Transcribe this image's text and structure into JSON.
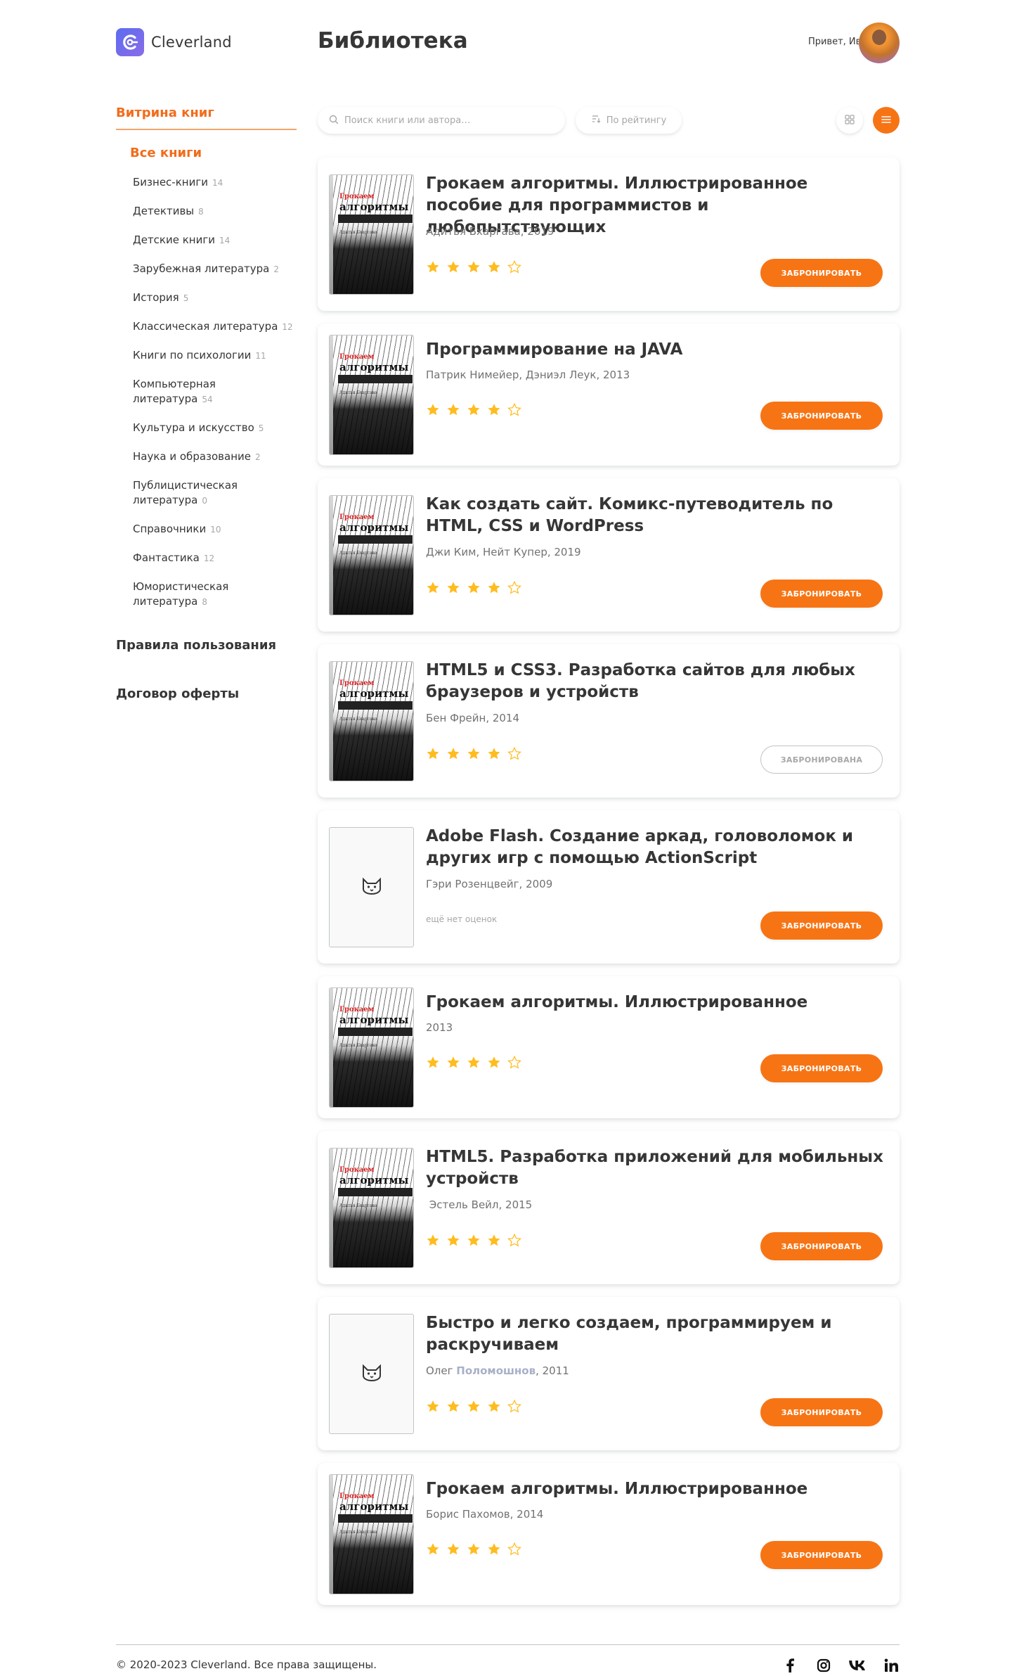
{
  "header": {
    "logo_text": "Cleverland",
    "page_title": "Библиотека",
    "greeting": "Привет, Иван!"
  },
  "sidebar": {
    "showcase_label": "Витрина книг",
    "all_books_label": "Все книги",
    "categories": [
      {
        "label": "Бизнес-книги",
        "count": "14"
      },
      {
        "label": "Детективы",
        "count": "8"
      },
      {
        "label": "Детские книги",
        "count": "14"
      },
      {
        "label": "Зарубежная литература",
        "count": "2"
      },
      {
        "label": "История",
        "count": "5"
      },
      {
        "label": "Классическая литература",
        "count": "12"
      },
      {
        "label": "Книги по психологии",
        "count": "11"
      },
      {
        "label": "Компьютерная литература",
        "count": "54"
      },
      {
        "label": "Культура и искусство",
        "count": "5"
      },
      {
        "label": "Наука и образование",
        "count": "2"
      },
      {
        "label": "Публицистическая литература",
        "count": "0"
      },
      {
        "label": "Справочники",
        "count": "10"
      },
      {
        "label": "Фантастика",
        "count": "12"
      },
      {
        "label": "Юмористическая литература",
        "count": "8"
      }
    ],
    "rules_label": "Правила пользования",
    "offer_label": "Договор оферты"
  },
  "toolbar": {
    "search_placeholder": "Поиск книги или автора…",
    "sort_label": "По рейтингу",
    "view_tile_icon": "grid-icon",
    "view_list_icon": "list-icon"
  },
  "colors": {
    "accent": "#f77414",
    "star": "#ffbc1f",
    "text": "#363636"
  },
  "books": [
    {
      "title": "Грокаем алгоритмы. Иллюстрированное пособие для программистов и любопытствующих",
      "author": "Адитья Бхаргава, 2019",
      "rating": 4,
      "has_cover": true,
      "button": "Забронировать",
      "booked": false
    },
    {
      "title": "Программирование на JAVA",
      "author": "Патрик Нимейер, Дэниэл Леук, 2013",
      "rating": 4,
      "has_cover": true,
      "button": "Забронировать",
      "booked": false
    },
    {
      "title": "Как создать сайт. Комикс-путеводитель по HTML, CSS и WordPress",
      "author": "Джи Ким, Нейт Купер, 2019",
      "rating": 4,
      "has_cover": true,
      "button": "Забронировать",
      "booked": false
    },
    {
      "title": "HTML5 и CSS3. Разработка сайтов для любых браузеров и устройств",
      "author": "Бен Фрейн, 2014",
      "rating": 4,
      "has_cover": true,
      "button": "Забронирована",
      "booked": true
    },
    {
      "title": "Adobe Flash. Создание аркад, головоломок и других игр с помощью ActionScript",
      "author": "Гэри Розенцвейг, 2009",
      "rating": 0,
      "no_rating_text": "ещё нет оценок",
      "has_cover": false,
      "button": "Забронировать",
      "booked": false
    },
    {
      "title": "Грокаем алгоритмы. Иллюстрированное",
      "author": "2013",
      "rating": 4,
      "has_cover": true,
      "button": "Забронировать",
      "booked": false
    },
    {
      "title": "HTML5. Разработка приложений для мобильных устройств",
      "author": " Эстель Вейл, 2015",
      "rating": 4,
      "has_cover": true,
      "button": "Забронировать",
      "booked": false
    },
    {
      "title": "Быстро и легко создаем, программируем и раскручиваем",
      "author_prefix": "Олег ",
      "author_highlight": "Поломошнов",
      "author_suffix": ", 2011",
      "rating": 4,
      "has_cover": false,
      "button": "Забронировать",
      "booked": false
    },
    {
      "title": "Грокаем алгоритмы. Иллюстрированное",
      "author": "Борис Пахомов, 2014",
      "rating": 4,
      "has_cover": true,
      "button": "Забронировать",
      "booked": false
    }
  ],
  "cover_text": {
    "line1": "Грокаем",
    "line2": "алгоритмы",
    "author": "Адитья Бхаргава"
  },
  "footer": {
    "copyright": "© 2020-2023 Cleverland. Все права защищены.",
    "socials": [
      {
        "icon": "facebook-icon",
        "glyph": "f"
      },
      {
        "icon": "instagram-icon",
        "glyph": ""
      },
      {
        "icon": "vk-icon",
        "glyph": "vk"
      },
      {
        "icon": "linkedin-icon",
        "glyph": "in"
      }
    ]
  }
}
